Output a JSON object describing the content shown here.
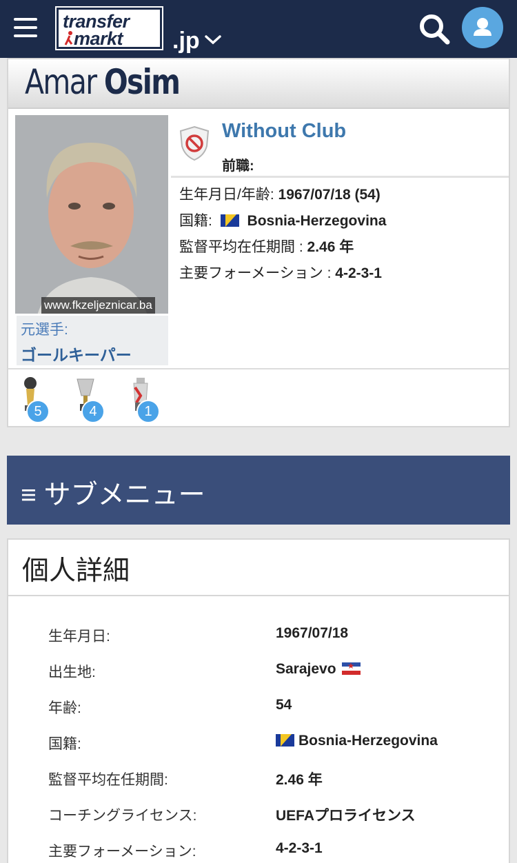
{
  "header": {
    "logo_line1": "transfer",
    "logo_line2": "markt",
    "tld": ".jp"
  },
  "profile": {
    "first_name": "Amar",
    "last_name": "Osim",
    "photo_credit": "www.fkzeljeznicar.ba",
    "former_label": "元選手:",
    "former_position": "ゴールキーパー",
    "club_name": "Without Club",
    "prev_label": "前職:",
    "facts": {
      "birth_label": "生年月日/年齢:",
      "birth_value": "1967/07/18 (54)",
      "nationality_label": "国籍:",
      "nationality_value": "Bosnia-Herzegovina",
      "tenure_label": "監督平均在任期間 :",
      "tenure_value": "2.46 年",
      "formation_label": "主要フォーメーション :",
      "formation_value": "4-2-3-1"
    },
    "trophies": [
      {
        "icon": "league-trophy-icon",
        "count": "5"
      },
      {
        "icon": "cup-trophy-icon",
        "count": "4"
      },
      {
        "icon": "super-cup-trophy-icon",
        "count": "1"
      }
    ]
  },
  "submenu": {
    "label": "≡ サブメニュー"
  },
  "details": {
    "title": "個人詳細",
    "rows": [
      {
        "key": "生年月日:",
        "value": "1967/07/18"
      },
      {
        "key": "出生地:",
        "value": "Sarajevo"
      },
      {
        "key": "年齢:",
        "value": "54"
      },
      {
        "key": "国籍:",
        "value": "Bosnia-Herzegovina"
      },
      {
        "key": "監督平均在任期間:",
        "value": "2.46 年"
      },
      {
        "key": "コーチングライセンス:",
        "value": "UEFAプロライセンス"
      },
      {
        "key": "主要フォーメーション:",
        "value": "4-2-3-1"
      }
    ]
  },
  "colors": {
    "header_bg": "#1c2b4a",
    "link_blue": "#3e78ad",
    "submenu_bg": "#3a4e7a",
    "badge_blue": "#4aa3e8"
  }
}
